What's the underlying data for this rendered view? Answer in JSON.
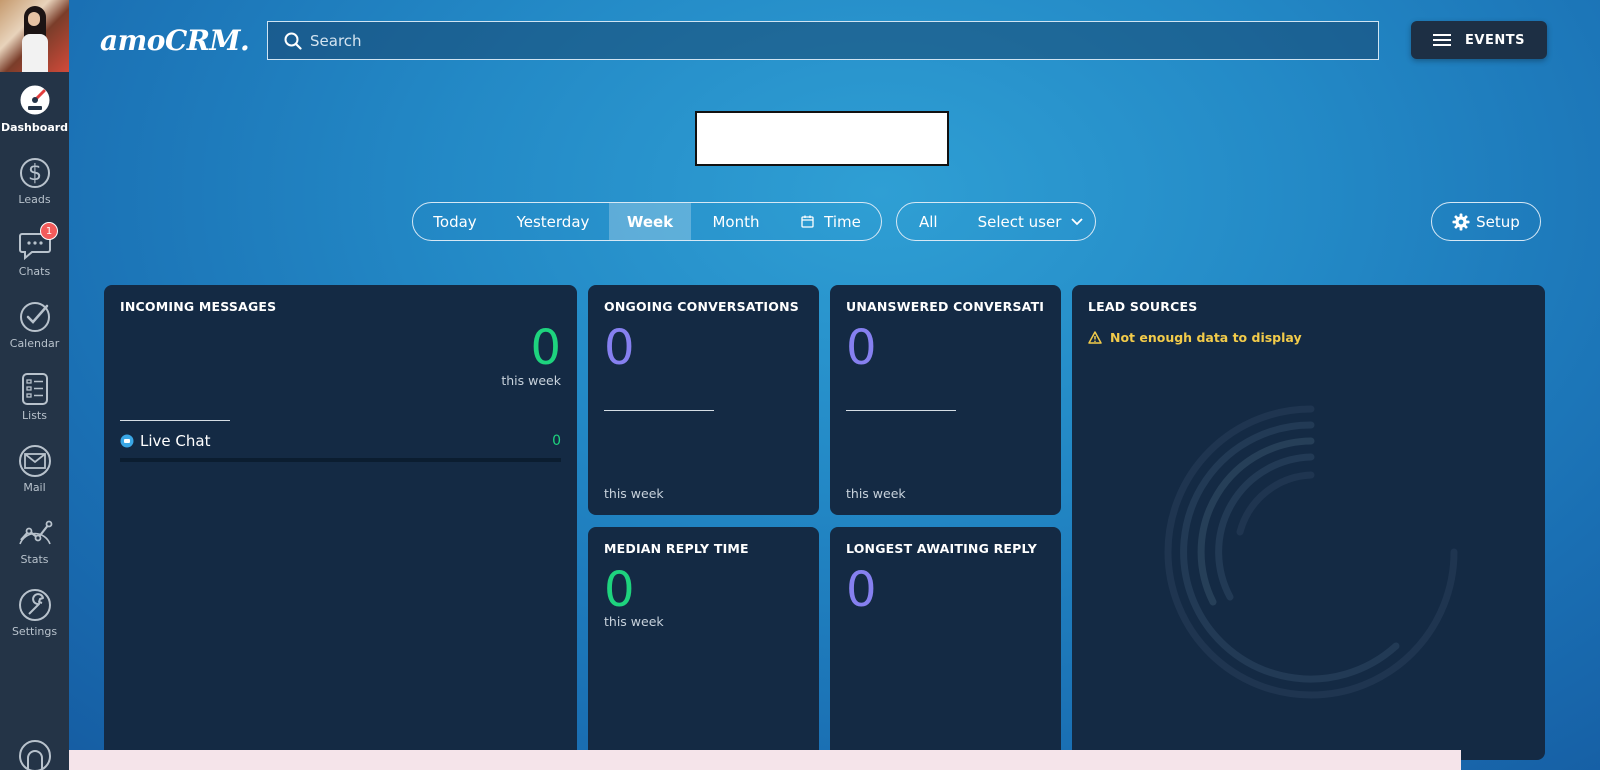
{
  "app": {
    "logo_text": "amoCRM."
  },
  "sidebar": {
    "items": [
      {
        "label": "Dashboard",
        "icon": "speedometer-icon",
        "active": true
      },
      {
        "label": "Leads",
        "icon": "dollar-icon"
      },
      {
        "label": "Chats",
        "icon": "chat-bubble-icon",
        "badge": "1"
      },
      {
        "label": "Calendar",
        "icon": "checkmark-icon"
      },
      {
        "label": "Lists",
        "icon": "list-icon"
      },
      {
        "label": "Mail",
        "icon": "envelope-icon"
      },
      {
        "label": "Stats",
        "icon": "chart-line-icon"
      },
      {
        "label": "Settings",
        "icon": "wrench-icon"
      }
    ]
  },
  "header": {
    "search_placeholder": "Search",
    "events_label": "EVENTS"
  },
  "filters": {
    "periods": [
      "Today",
      "Yesterday",
      "Week",
      "Month",
      "Time"
    ],
    "active_period": "Week",
    "users_all": "All",
    "users_select": "Select user",
    "setup_label": "Setup"
  },
  "widgets": {
    "incoming": {
      "title": "INCOMING MESSAGES",
      "value": "0",
      "sub": "this week",
      "channel_label": "Live Chat",
      "channel_value": "0"
    },
    "ongoing": {
      "title": "ONGOING CONVERSATIONS",
      "value": "0",
      "sub": "this week"
    },
    "unanswered": {
      "title": "UNANSWERED CONVERSATI",
      "value": "0",
      "sub": "this week"
    },
    "lead_sources": {
      "title": "LEAD SOURCES",
      "warning": "Not enough data to display"
    },
    "median": {
      "title": "MEDIAN REPLY TIME",
      "value": "0",
      "sub": "this week"
    },
    "longest": {
      "title": "LONGEST AWAITING REPLY",
      "value": "0"
    }
  },
  "colors": {
    "accent_green": "#1ed37e",
    "accent_purple": "#8680f0",
    "warning_yellow": "#f2cb4a",
    "badge_red": "#f25b5b"
  }
}
